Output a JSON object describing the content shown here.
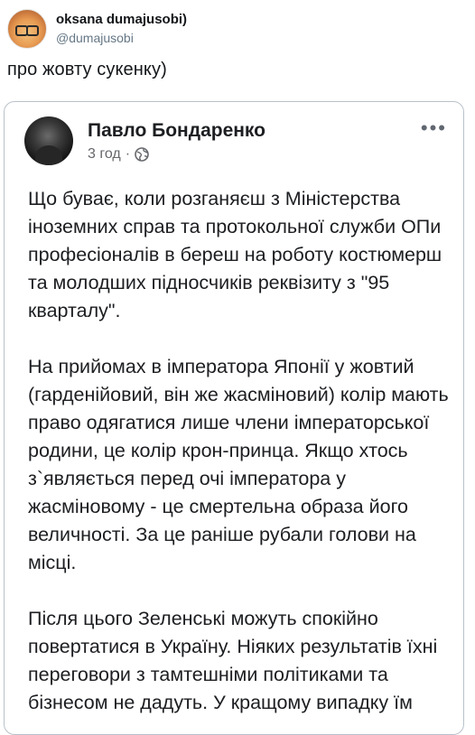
{
  "tweet": {
    "display_name": "oksana dumajusobi)",
    "handle": "@dumajusobi",
    "text": "про жовту сукенку)"
  },
  "post": {
    "author": "Павло Бондаренко",
    "time": "3 год",
    "separator": "·",
    "more_label": "•••",
    "paragraphs": [
      "Що буває, коли розганяєш з Міністерства іноземних справ та протокольної служби ОПи професіоналів в береш на роботу костюмерш та молодших підносчиків реквізиту з \"95 кварталу\".",
      "На прийомах в імператора Японії у жовтий (гарденійовий, він же жасміновий) колір мають право одягатися лише члени імператорської родини, це колір крон-принца. Якщо хтось з`являється перед очі імператора у жасміновому - це смертельна образа його величності. За це раніше рубали голови на місці.",
      "Після цього Зеленські можуть спокійно повертатися в Україну. Ніяких результатів їхні переговори з тамтешніми політиками та бізнесом не дадуть. У кращому випадку їм"
    ]
  },
  "icons": {
    "tweet_avatar": "fox-avatar-icon",
    "post_avatar": "profile-photo-icon",
    "visibility": "globe-icon",
    "menu": "more-options-icon"
  }
}
